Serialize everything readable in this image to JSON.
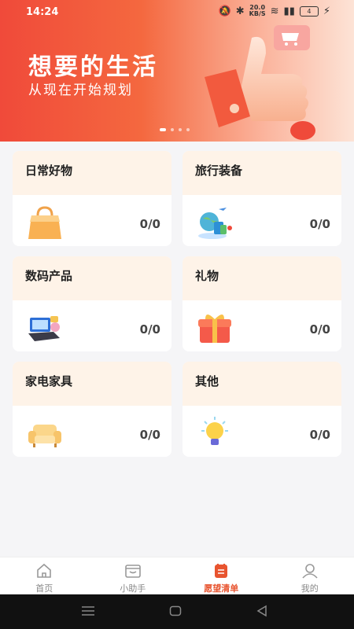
{
  "status": {
    "time": "14:24",
    "net_speed": "20.0",
    "net_unit": "KB/S",
    "battery": "4"
  },
  "banner": {
    "title": "想要的生活",
    "subtitle": "从现在开始规划"
  },
  "categories": [
    {
      "name": "日常好物",
      "count": "0/0",
      "icon": "shopping-bag-icon"
    },
    {
      "name": "旅行装备",
      "count": "0/0",
      "icon": "travel-globe-icon"
    },
    {
      "name": "数码产品",
      "count": "0/0",
      "icon": "laptop-icon"
    },
    {
      "name": "礼物",
      "count": "0/0",
      "icon": "gift-box-icon"
    },
    {
      "name": "家电家具",
      "count": "0/0",
      "icon": "sofa-icon"
    },
    {
      "name": "其他",
      "count": "0/0",
      "icon": "lightbulb-icon"
    }
  ],
  "tabs": [
    {
      "label": "首页",
      "icon": "home-icon"
    },
    {
      "label": "小助手",
      "icon": "assistant-icon"
    },
    {
      "label": "愿望清单",
      "icon": "wishlist-icon"
    },
    {
      "label": "我的",
      "icon": "profile-icon"
    }
  ],
  "colors": {
    "accent": "#e8542f",
    "card_header": "#fef3e8"
  }
}
